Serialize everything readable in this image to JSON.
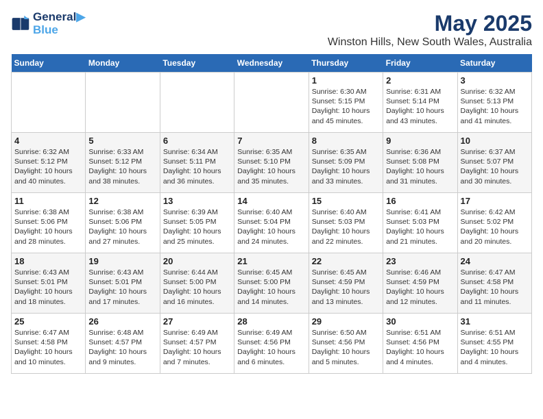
{
  "logo": {
    "line1": "General",
    "line2": "Blue"
  },
  "title": "May 2025",
  "subtitle": "Winston Hills, New South Wales, Australia",
  "days_header": [
    "Sunday",
    "Monday",
    "Tuesday",
    "Wednesday",
    "Thursday",
    "Friday",
    "Saturday"
  ],
  "weeks": [
    [
      {
        "day": "",
        "info": ""
      },
      {
        "day": "",
        "info": ""
      },
      {
        "day": "",
        "info": ""
      },
      {
        "day": "",
        "info": ""
      },
      {
        "day": "1",
        "info": "Sunrise: 6:30 AM\nSunset: 5:15 PM\nDaylight: 10 hours\nand 45 minutes."
      },
      {
        "day": "2",
        "info": "Sunrise: 6:31 AM\nSunset: 5:14 PM\nDaylight: 10 hours\nand 43 minutes."
      },
      {
        "day": "3",
        "info": "Sunrise: 6:32 AM\nSunset: 5:13 PM\nDaylight: 10 hours\nand 41 minutes."
      }
    ],
    [
      {
        "day": "4",
        "info": "Sunrise: 6:32 AM\nSunset: 5:12 PM\nDaylight: 10 hours\nand 40 minutes."
      },
      {
        "day": "5",
        "info": "Sunrise: 6:33 AM\nSunset: 5:12 PM\nDaylight: 10 hours\nand 38 minutes."
      },
      {
        "day": "6",
        "info": "Sunrise: 6:34 AM\nSunset: 5:11 PM\nDaylight: 10 hours\nand 36 minutes."
      },
      {
        "day": "7",
        "info": "Sunrise: 6:35 AM\nSunset: 5:10 PM\nDaylight: 10 hours\nand 35 minutes."
      },
      {
        "day": "8",
        "info": "Sunrise: 6:35 AM\nSunset: 5:09 PM\nDaylight: 10 hours\nand 33 minutes."
      },
      {
        "day": "9",
        "info": "Sunrise: 6:36 AM\nSunset: 5:08 PM\nDaylight: 10 hours\nand 31 minutes."
      },
      {
        "day": "10",
        "info": "Sunrise: 6:37 AM\nSunset: 5:07 PM\nDaylight: 10 hours\nand 30 minutes."
      }
    ],
    [
      {
        "day": "11",
        "info": "Sunrise: 6:38 AM\nSunset: 5:06 PM\nDaylight: 10 hours\nand 28 minutes."
      },
      {
        "day": "12",
        "info": "Sunrise: 6:38 AM\nSunset: 5:06 PM\nDaylight: 10 hours\nand 27 minutes."
      },
      {
        "day": "13",
        "info": "Sunrise: 6:39 AM\nSunset: 5:05 PM\nDaylight: 10 hours\nand 25 minutes."
      },
      {
        "day": "14",
        "info": "Sunrise: 6:40 AM\nSunset: 5:04 PM\nDaylight: 10 hours\nand 24 minutes."
      },
      {
        "day": "15",
        "info": "Sunrise: 6:40 AM\nSunset: 5:03 PM\nDaylight: 10 hours\nand 22 minutes."
      },
      {
        "day": "16",
        "info": "Sunrise: 6:41 AM\nSunset: 5:03 PM\nDaylight: 10 hours\nand 21 minutes."
      },
      {
        "day": "17",
        "info": "Sunrise: 6:42 AM\nSunset: 5:02 PM\nDaylight: 10 hours\nand 20 minutes."
      }
    ],
    [
      {
        "day": "18",
        "info": "Sunrise: 6:43 AM\nSunset: 5:01 PM\nDaylight: 10 hours\nand 18 minutes."
      },
      {
        "day": "19",
        "info": "Sunrise: 6:43 AM\nSunset: 5:01 PM\nDaylight: 10 hours\nand 17 minutes."
      },
      {
        "day": "20",
        "info": "Sunrise: 6:44 AM\nSunset: 5:00 PM\nDaylight: 10 hours\nand 16 minutes."
      },
      {
        "day": "21",
        "info": "Sunrise: 6:45 AM\nSunset: 5:00 PM\nDaylight: 10 hours\nand 14 minutes."
      },
      {
        "day": "22",
        "info": "Sunrise: 6:45 AM\nSunset: 4:59 PM\nDaylight: 10 hours\nand 13 minutes."
      },
      {
        "day": "23",
        "info": "Sunrise: 6:46 AM\nSunset: 4:59 PM\nDaylight: 10 hours\nand 12 minutes."
      },
      {
        "day": "24",
        "info": "Sunrise: 6:47 AM\nSunset: 4:58 PM\nDaylight: 10 hours\nand 11 minutes."
      }
    ],
    [
      {
        "day": "25",
        "info": "Sunrise: 6:47 AM\nSunset: 4:58 PM\nDaylight: 10 hours\nand 10 minutes."
      },
      {
        "day": "26",
        "info": "Sunrise: 6:48 AM\nSunset: 4:57 PM\nDaylight: 10 hours\nand 9 minutes."
      },
      {
        "day": "27",
        "info": "Sunrise: 6:49 AM\nSunset: 4:57 PM\nDaylight: 10 hours\nand 7 minutes."
      },
      {
        "day": "28",
        "info": "Sunrise: 6:49 AM\nSunset: 4:56 PM\nDaylight: 10 hours\nand 6 minutes."
      },
      {
        "day": "29",
        "info": "Sunrise: 6:50 AM\nSunset: 4:56 PM\nDaylight: 10 hours\nand 5 minutes."
      },
      {
        "day": "30",
        "info": "Sunrise: 6:51 AM\nSunset: 4:56 PM\nDaylight: 10 hours\nand 4 minutes."
      },
      {
        "day": "31",
        "info": "Sunrise: 6:51 AM\nSunset: 4:55 PM\nDaylight: 10 hours\nand 4 minutes."
      }
    ]
  ]
}
